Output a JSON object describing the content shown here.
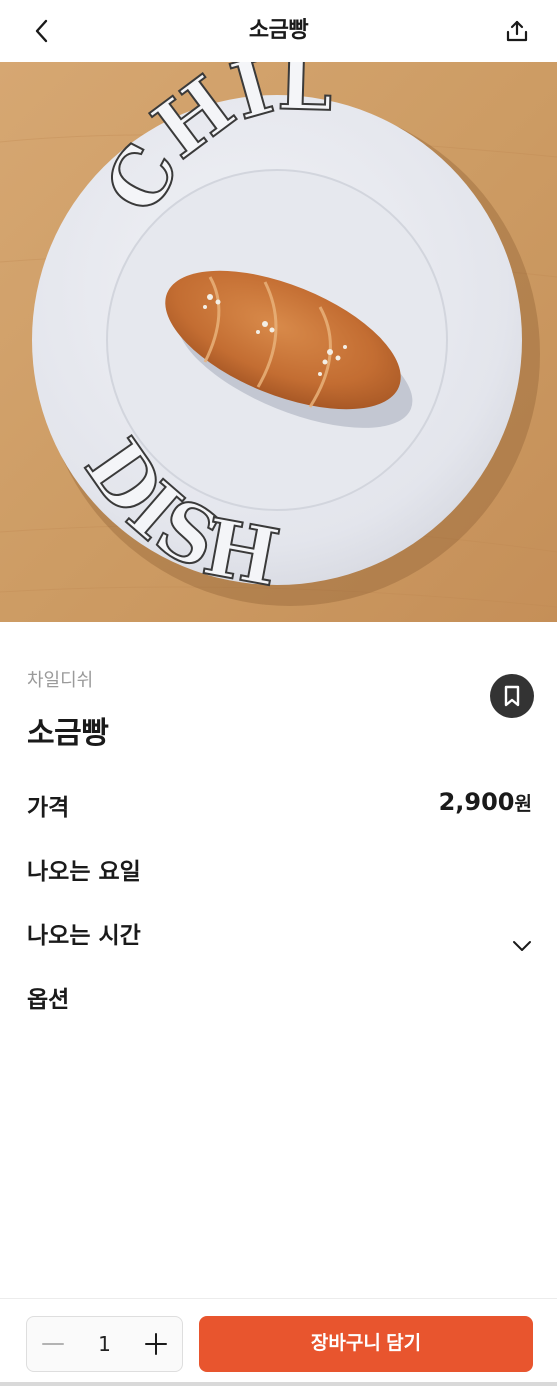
{
  "header": {
    "title": "소금빵",
    "back_icon": "chevron-left-icon",
    "share_icon": "share-icon"
  },
  "product": {
    "plate_text_top": "CHIL",
    "plate_text_bottom": "DISH",
    "brand": "차일디쉬",
    "name": "소금빵",
    "bookmark_icon": "bookmark-icon"
  },
  "details": {
    "price_label": "가격",
    "price_value": "2,900",
    "price_unit": "원",
    "days_label": "나오는 요일",
    "time_label": "나오는 시간",
    "options_label": "옵션",
    "expand_icon": "chevron-down-icon"
  },
  "bottom_bar": {
    "quantity": "1",
    "minus_icon": "minus-icon",
    "plus_icon": "plus-icon",
    "add_to_cart_label": "장바구니 담기"
  },
  "colors": {
    "accent": "#e8552e",
    "bookmark_bg": "#333333",
    "table_wood": "#cfa06a",
    "plate": "#e9eaf0"
  }
}
